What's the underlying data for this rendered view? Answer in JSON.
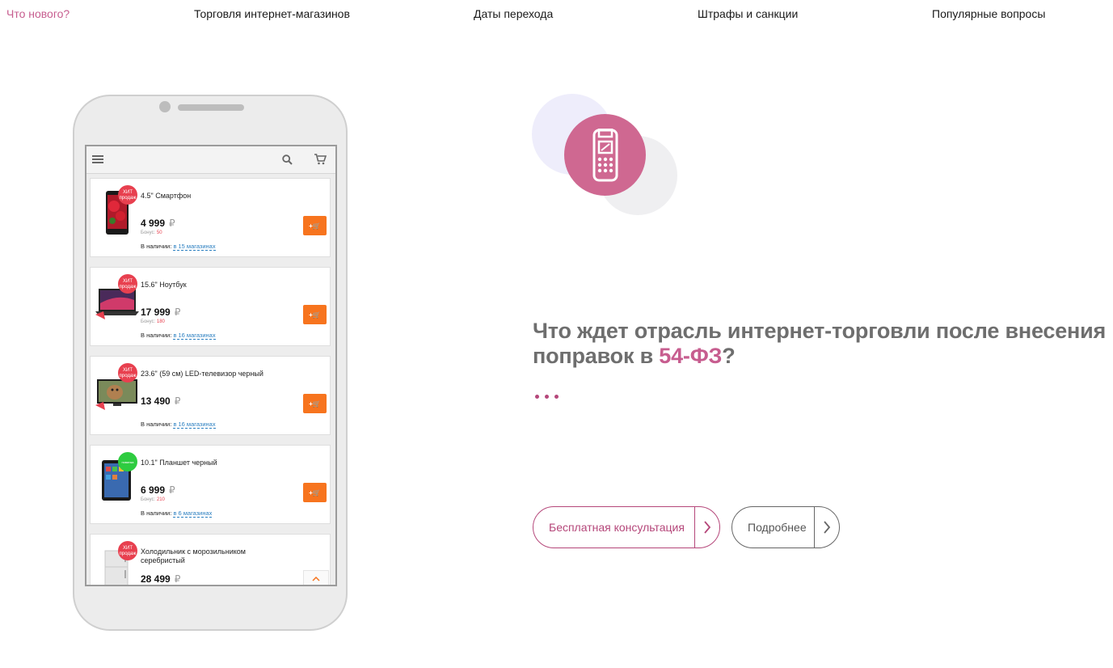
{
  "nav": {
    "items": [
      {
        "label": "Что нового?",
        "active": true
      },
      {
        "label": "Торговля интернет-магазинов"
      },
      {
        "label": "Даты перехода"
      },
      {
        "label": "Штрафы и санкции"
      },
      {
        "label": "Популярные вопросы"
      }
    ]
  },
  "phone": {
    "app_bar_icons": [
      "menu-icon",
      "search-icon",
      "cart-icon"
    ],
    "products": [
      {
        "title": "4.5\" Смартфон",
        "badge": "ХИТ продаж",
        "price": "4 999",
        "currency": "₽",
        "bonus_label": "Бонус:",
        "bonus": "50",
        "avail_label": "В наличии:",
        "avail_link": "в 15 магазинах",
        "cart": "+🛒"
      },
      {
        "title": "15.6\" Ноутбук",
        "badge": "ХИТ продаж",
        "price": "17 999",
        "currency": "₽",
        "bonus_label": "Бонус:",
        "bonus": "180",
        "avail_label": "В наличии:",
        "avail_link": "в 16 магазинах",
        "cart": "+🛒"
      },
      {
        "title": "23.6\" (59 см) LED-телевизор черный",
        "badge": "ХИТ продаж",
        "price": "13 490",
        "currency": "₽",
        "bonus_label": "",
        "bonus": "",
        "avail_label": "В наличии:",
        "avail_link": "в 16 магазинах",
        "cart": "+🛒"
      },
      {
        "title": "10.1\" Планшет черный",
        "badge": "новинка",
        "price": "6 999",
        "currency": "₽",
        "bonus_label": "Бонус:",
        "bonus": "210",
        "avail_label": "В наличии:",
        "avail_link": "в 6 магазинах",
        "cart": "+🛒"
      },
      {
        "title": "Холодильник с морозильником серебристый",
        "badge": "ХИТ продаж",
        "price": "28 499",
        "currency": "₽",
        "bonus_label": "",
        "bonus": "",
        "avail_label": "",
        "avail_link": "",
        "cart": "+🛒"
      }
    ]
  },
  "hero": {
    "icon": "pos-terminal-icon",
    "headline_part1": "Что ждет отрасль интернет-торговли после внесения поправок в ",
    "headline_highlight": "54-ФЗ",
    "headline_part2": "?",
    "buttons": {
      "consult": "Бесплатная консультация",
      "more": "Подробнее"
    }
  },
  "colors": {
    "accent": "#c75d8f",
    "accent_dark": "#b5477a",
    "cart_orange": "#f7741e",
    "badge_red": "#e8404f",
    "badge_green": "#2ecc40",
    "link_blue": "#2b7fc0"
  }
}
